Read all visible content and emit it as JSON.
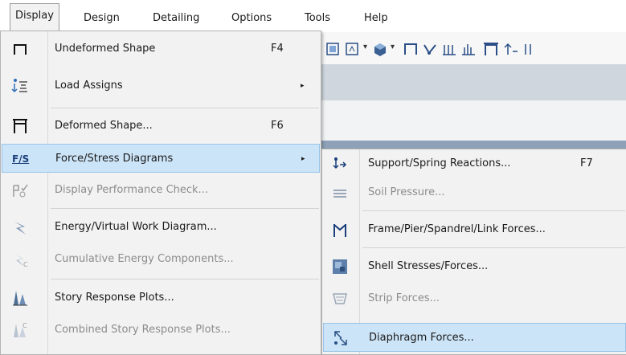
{
  "menubar": {
    "items": [
      {
        "label": "Display"
      },
      {
        "label": "Design"
      },
      {
        "label": "Detailing"
      },
      {
        "label": "Options"
      },
      {
        "label": "Tools"
      },
      {
        "label": "Help"
      }
    ]
  },
  "display_menu": {
    "items": [
      {
        "label": "Undeformed Shape",
        "shortcut": "F4",
        "icon": "undeformed-shape-icon"
      },
      {
        "label": "Load Assigns",
        "submenu": "▸",
        "icon": "load-assigns-icon"
      },
      {
        "label": "Deformed Shape...",
        "shortcut": "F6",
        "icon": "deformed-shape-icon"
      },
      {
        "label": "Force/Stress Diagrams",
        "submenu": "▸",
        "icon": "force-stress-icon",
        "icon_text": "F/S"
      },
      {
        "label": "Display Performance Check...",
        "icon": "performance-check-icon"
      },
      {
        "label": "Energy/Virtual Work Diagram...",
        "icon": "energy-diagram-icon"
      },
      {
        "label": "Cumulative Energy Components...",
        "icon": "cumulative-energy-icon"
      },
      {
        "label": "Story Response Plots...",
        "icon": "story-response-icon"
      },
      {
        "label": "Combined Story Response Plots...",
        "icon": "combined-story-response-icon"
      }
    ]
  },
  "submenu": {
    "items": [
      {
        "label": "Support/Spring Reactions...",
        "shortcut": "F7",
        "icon": "support-reactions-icon"
      },
      {
        "label": "Soil Pressure...",
        "icon": "soil-pressure-icon"
      },
      {
        "label": "Frame/Pier/Spandrel/Link Forces...",
        "icon": "frame-forces-icon"
      },
      {
        "label": "Shell Stresses/Forces...",
        "icon": "shell-stresses-icon"
      },
      {
        "label": "Strip Forces...",
        "icon": "strip-forces-icon"
      },
      {
        "label": "Diaphragm Forces...",
        "icon": "diaphragm-forces-icon"
      }
    ]
  },
  "colors": {
    "menu_bg": "#f2f2f2",
    "highlight": "#cce4f7",
    "highlight_border": "#97c3e9",
    "disabled_text": "#8c8c8c"
  }
}
